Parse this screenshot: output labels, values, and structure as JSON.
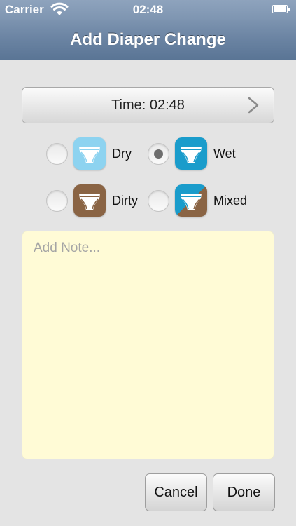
{
  "status_bar": {
    "carrier": "Carrier",
    "time": "02:48"
  },
  "nav": {
    "title": "Add Diaper Change"
  },
  "time_button": {
    "label": "Time: 02:48"
  },
  "types": [
    {
      "label": "Dry",
      "selected": false,
      "icon": "dry-diaper-icon",
      "color": "#8dd3f0"
    },
    {
      "label": "Wet",
      "selected": true,
      "icon": "wet-diaper-icon",
      "color": "#1a9ccb"
    },
    {
      "label": "Dirty",
      "selected": false,
      "icon": "dirty-diaper-icon",
      "color": "#8a6444"
    },
    {
      "label": "Mixed",
      "selected": false,
      "icon": "mixed-diaper-icon",
      "color": "#1a9ccb"
    }
  ],
  "note": {
    "placeholder": "Add Note...",
    "value": ""
  },
  "buttons": {
    "cancel": "Cancel",
    "done": "Done"
  }
}
